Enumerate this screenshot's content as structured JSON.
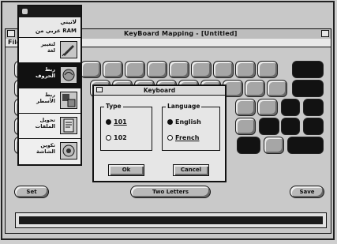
{
  "window": {
    "title": "KeyBoard Mapping - [Untitled]"
  },
  "menubar": {
    "file_label": "File"
  },
  "palette": {
    "header_title": "لاتيني\nعربي من RAM",
    "items": [
      {
        "label": "لتغيير\nلغة",
        "icon": "pen-icon",
        "selected": false
      },
      {
        "label": "ربط\nالحروف",
        "icon": "map-icon",
        "selected": true
      },
      {
        "label": "ربط\nالأسطر",
        "icon": "link-icon",
        "selected": false
      },
      {
        "label": "تحويل\nالملفات",
        "icon": "file-icon",
        "selected": false
      },
      {
        "label": "تكوين\nالشاشة",
        "icon": "screen-icon",
        "selected": false
      }
    ]
  },
  "keyboard": {
    "key_color": "#a6a6a6",
    "dark_key_color": "#121212"
  },
  "buttons": {
    "left_label": "Set",
    "center_label": "Two Letters",
    "right_label": "Save"
  },
  "dialog": {
    "title": "Keyboard",
    "type_group": {
      "legend": "Type",
      "options": [
        {
          "label": "101",
          "selected": true
        },
        {
          "label": "102",
          "selected": false
        }
      ]
    },
    "language_group": {
      "legend": "Language",
      "options": [
        {
          "label": "English",
          "selected": true
        },
        {
          "label": "French",
          "selected": false
        }
      ]
    },
    "ok_label": "Ok",
    "cancel_label": "Cancel"
  }
}
